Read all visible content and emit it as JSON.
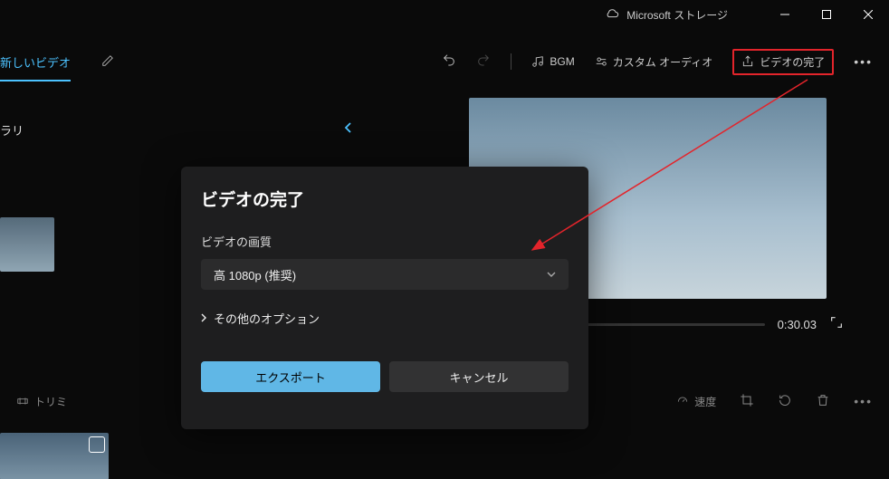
{
  "titlebar": {
    "storage_label": "Microsoft ストレージ"
  },
  "toolbar": {
    "new_video_tab": "新しいビデオ",
    "bgm_label": "BGM",
    "custom_audio_label": "カスタム オーディオ",
    "finish_label": "ビデオの完了"
  },
  "sidebar": {
    "library_label": "ラリ"
  },
  "preview": {
    "time": "0:30.03"
  },
  "bottom": {
    "trim_label": "トリミ",
    "speed_label": "速度"
  },
  "dialog": {
    "title": "ビデオの完了",
    "quality_label": "ビデオの画質",
    "quality_value": "高 1080p (推奨)",
    "more_options": "その他のオプション",
    "export_btn": "エクスポート",
    "cancel_btn": "キャンセル"
  }
}
